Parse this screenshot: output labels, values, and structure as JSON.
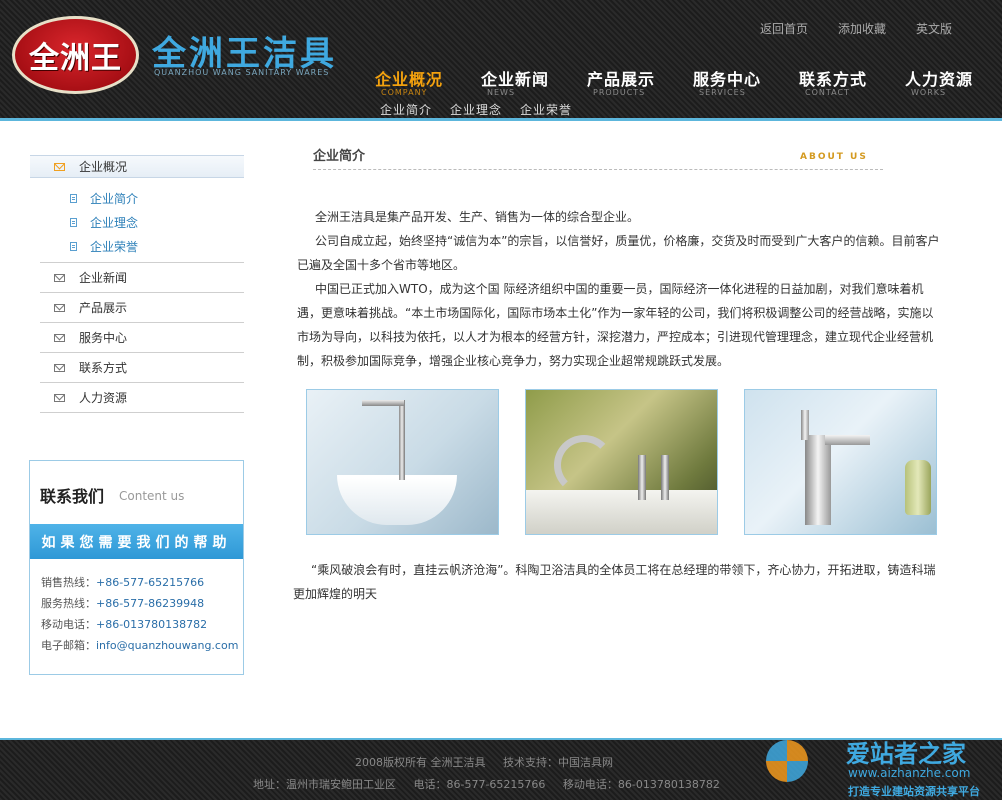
{
  "header": {
    "logo_badge": "全洲王",
    "logo_title": "全洲王洁具",
    "logo_subtitle": "QUANZHOU WANG SANITARY WARES",
    "top_links": [
      "返回首页",
      "添加收藏",
      "英文版"
    ],
    "nav": [
      {
        "cn": "企业概况",
        "en": "COMPANY",
        "active": true
      },
      {
        "cn": "企业新闻",
        "en": "NEWS"
      },
      {
        "cn": "产品展示",
        "en": "PRODUCTS"
      },
      {
        "cn": "服务中心",
        "en": "SERVICES"
      },
      {
        "cn": "联系方式",
        "en": "CONTACT"
      },
      {
        "cn": "人力资源",
        "en": "WORKS"
      }
    ],
    "sub_nav": [
      "企业简介",
      "企业理念",
      "企业荣誉"
    ],
    "accent_color": "#f4a20e",
    "border_color": "#5cb6dc"
  },
  "sidebar": {
    "head_label": "企业概况",
    "sub_items": [
      "企业简介",
      "企业理念",
      "企业荣誉"
    ],
    "items": [
      "企业新闻",
      "产品展示",
      "服务中心",
      "联系方式",
      "人力资源"
    ]
  },
  "contact": {
    "title": "联系我们",
    "title_en": "Content us",
    "banner": "如果您需要我们的帮助",
    "lines": [
      {
        "label": "销售热线：",
        "value": "+86-577-65215766"
      },
      {
        "label": "服务热线：",
        "value": "+86-577-86239948"
      },
      {
        "label": "移动电话：",
        "value": "+86-013780138782"
      },
      {
        "label": "电子邮箱：",
        "value": "info@quanzhouwang.com"
      }
    ]
  },
  "main": {
    "title": "企业简介",
    "title_en": "ABOUT US",
    "paragraphs": [
      "全洲王洁具是集产品开发、生产、销售为一体的综合型企业。",
      "公司自成立起，始终坚持“诚信为本”的宗旨，以信誉好，质量优，价格廉，交货及时而受到广大客户的信赖。目前客户已遍及全国十多个省市等地区。",
      "中国已正式加入WTO，成为这个国 际经济组织中国的重要一员，国际经济一体化进程的日益加剧，对我们意味着机遇，更意味着挑战。“本土市场国际化，国际市场本土化”作为一家年轻的公司，我们将积极调整公司的经营战略，实施以市场为导向，以科技为依托，以人才为根本的经营方针，深挖潜力，严控成本；引进现代管理理念，建立现代企业经营机制，积极参加国际竞争，增强企业核心竞争力，努力实现企业超常规跳跃式发展。"
    ],
    "closing": "“乘风破浪会有时，直挂云帆济沧海”。科陶卫浴洁具的全体员工将在总经理的带领下，齐心协力，开拓进取，铸造科瑞更加辉煌的明天"
  },
  "footer": {
    "line1": [
      "2008版权所有 全洲王洁具",
      "技术支持：中国洁具网"
    ],
    "line2": [
      "地址：温州市瑞安鲍田工业区",
      "电话：86-577-65215766",
      "移动电话：86-013780138782"
    ]
  },
  "watermark": {
    "title": "爱站者之家",
    "url": "www.aizhanzhe.com",
    "slogan": "打造专业建站资源共享平台"
  }
}
